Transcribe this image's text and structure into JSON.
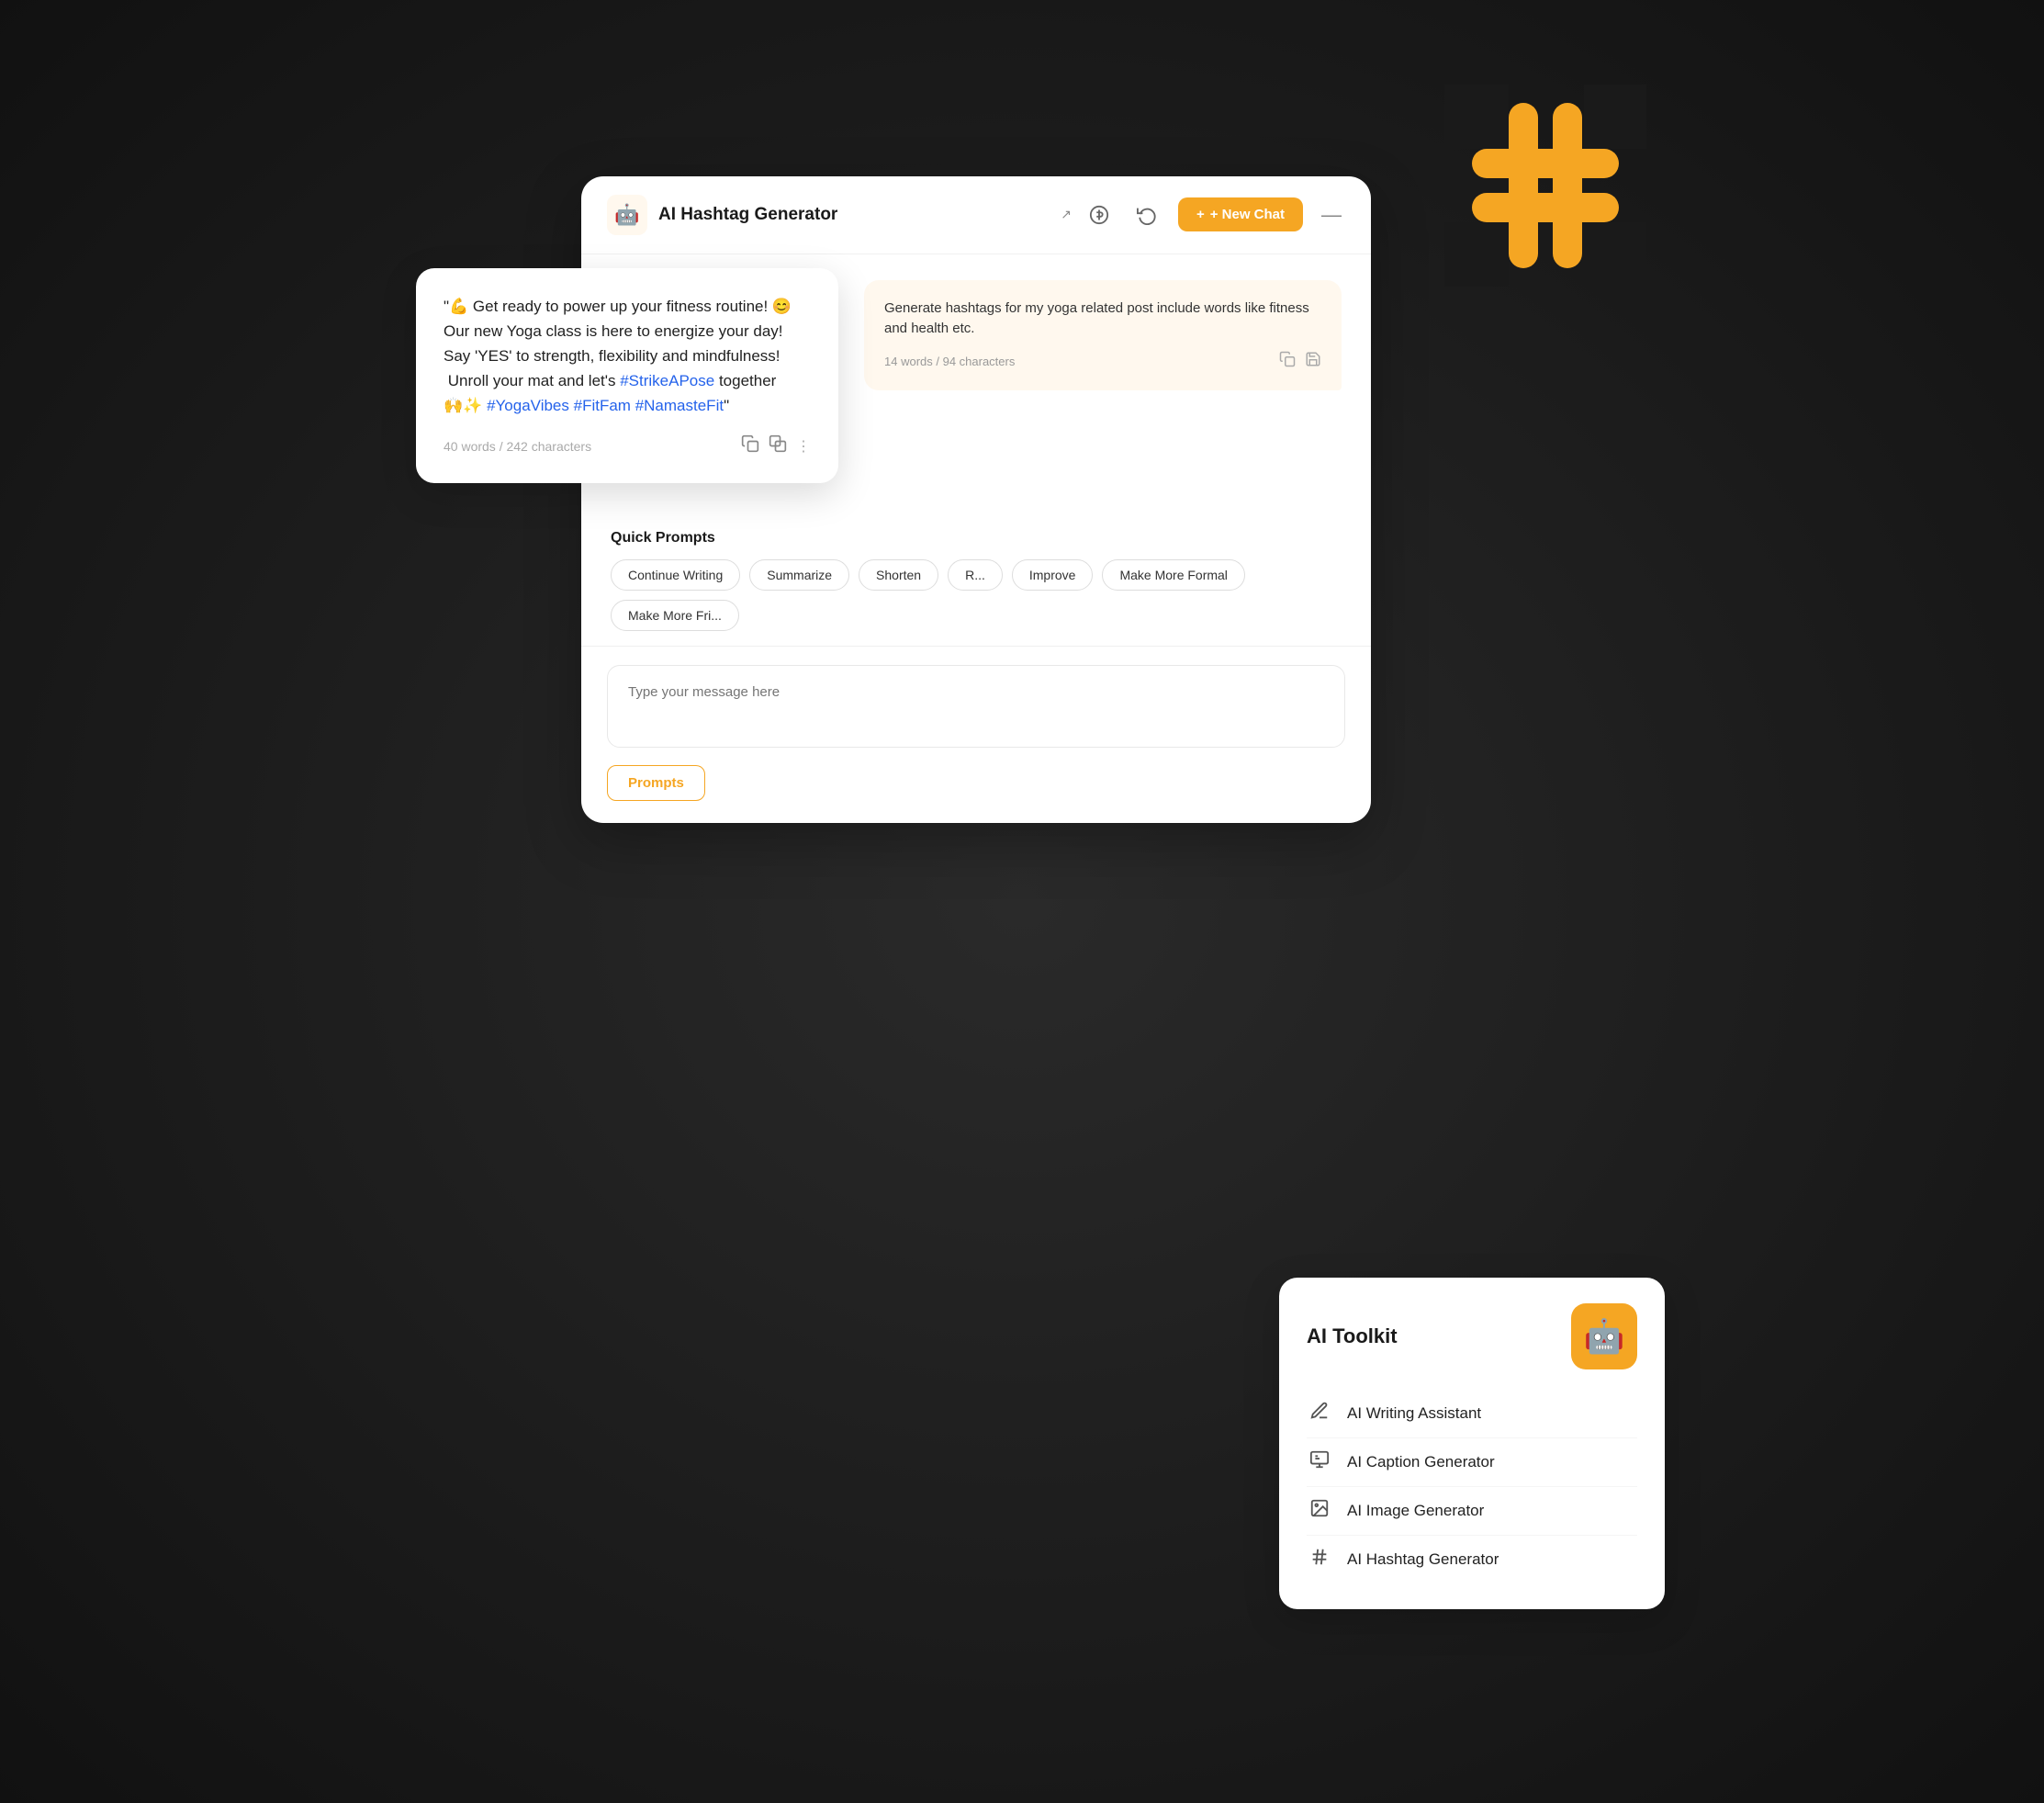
{
  "header": {
    "robot_emoji": "🤖",
    "title": "AI Hashtag Generator",
    "new_chat_label": "+ New Chat",
    "minimize_label": "—"
  },
  "ai_response": {
    "text": "\"💪 Get ready to power up your fitness routine! 😊\nOur new Yoga class is here to energize your day!\nSay 'YES' to strength, flexibility and mindfulness!\n Unroll your mat and let's ",
    "hashtag1": "#StrikeAPose",
    "text2": " together\n🙌✨ ",
    "hashtag2": "#YogaVibes",
    "text3": " ",
    "hashtag3": "#FitFam",
    "text4": " ",
    "hashtag4": "#NamasteFit",
    "text5": "\"",
    "word_count": "40 words / 242 characters"
  },
  "user_message": {
    "text": "Generate hashtags for my yoga related post include  words like fitness and health etc.",
    "word_count": "14 words / 94 characters"
  },
  "quick_prompts": {
    "title": "Quick Prompts",
    "chips": [
      "Continue Writing",
      "Summarize",
      "Shorten",
      "R...",
      "Improve",
      "Make More Formal",
      "Make More Fri..."
    ]
  },
  "input": {
    "placeholder": "Type your message here"
  },
  "prompts_button": {
    "label": "Prompts"
  },
  "ai_toolkit": {
    "title": "AI Toolkit",
    "items": [
      {
        "label": "AI Writing Assistant",
        "icon": "✏️"
      },
      {
        "label": "AI Caption Generator",
        "icon": "📝"
      },
      {
        "label": "AI Image Generator",
        "icon": "🖼️"
      },
      {
        "label": "AI Hashtag Generator",
        "icon": "#️⃣"
      }
    ]
  }
}
